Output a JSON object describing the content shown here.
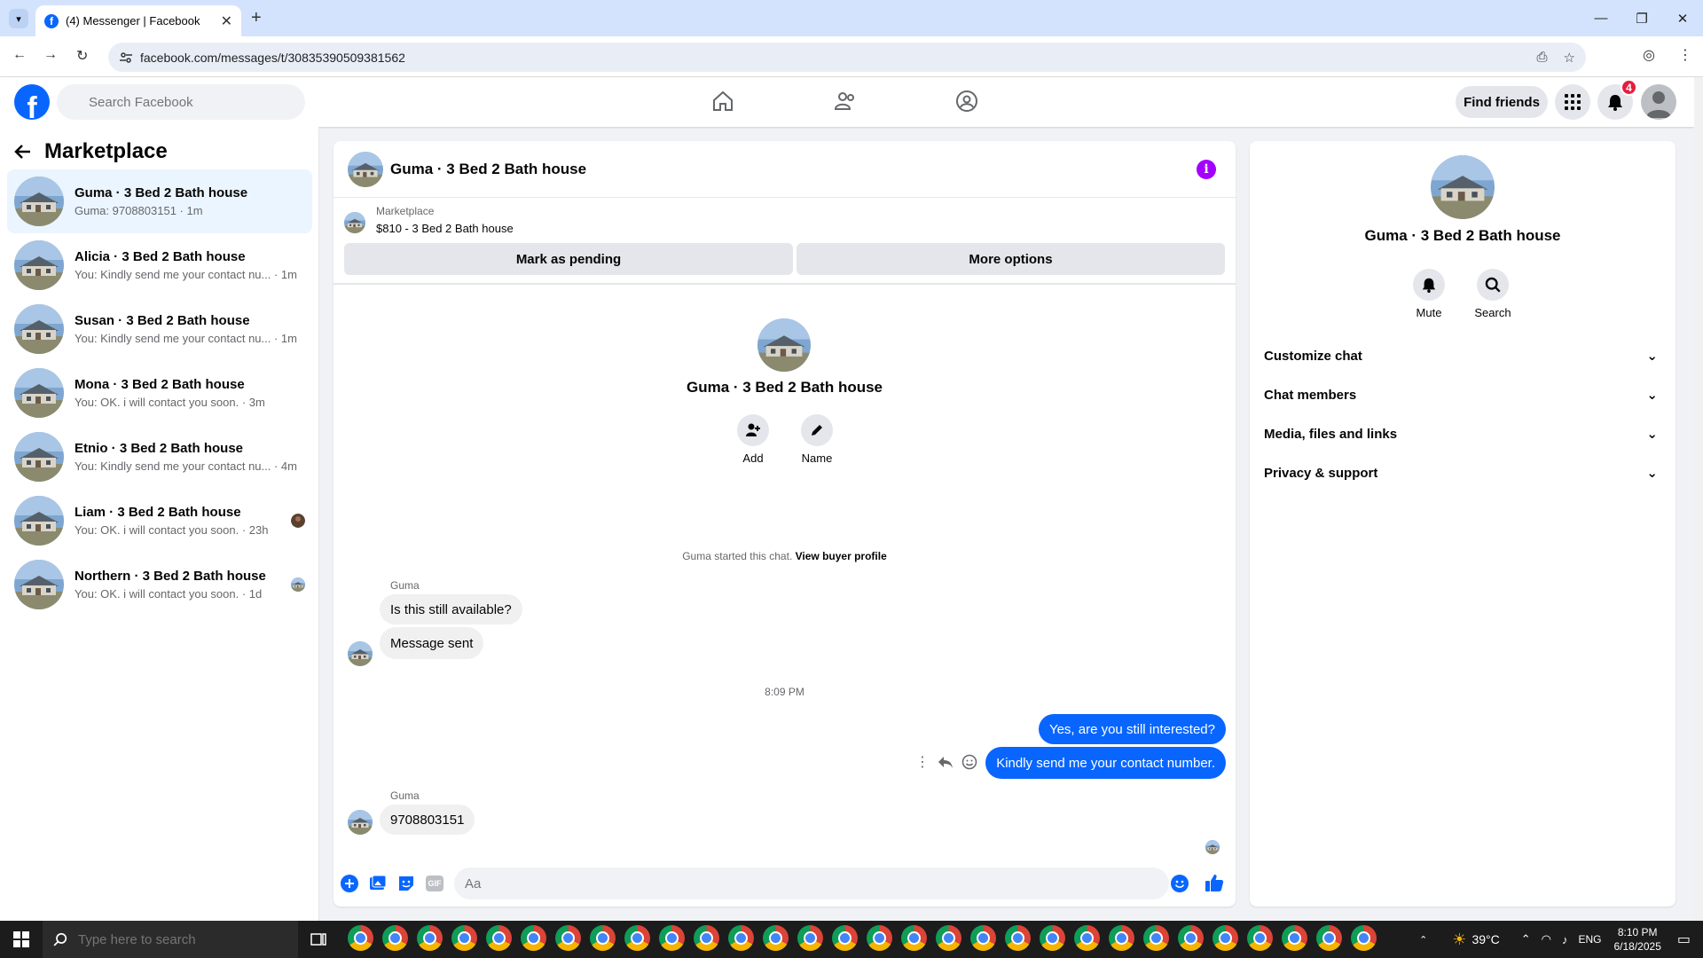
{
  "browser": {
    "tab_title": "(4) Messenger | Facebook",
    "url": "facebook.com/messages/t/30835390509381562"
  },
  "fb": {
    "logo_letter": "f",
    "search_placeholder": "Search Facebook",
    "find_friends": "Find friends",
    "notif_count": "4"
  },
  "sidebar": {
    "title": "Marketplace",
    "conversations": [
      {
        "name": "Guma · 3 Bed 2 Bath house",
        "preview": "Guma: 9708803151 · 1m"
      },
      {
        "name": "Alicia · 3 Bed 2 Bath house",
        "preview": "You: Kindly send me your contact nu... · 1m"
      },
      {
        "name": "Susan · 3 Bed 2 Bath house",
        "preview": "You: Kindly send me your contact nu... · 1m"
      },
      {
        "name": "Mona · 3 Bed 2 Bath house",
        "preview": "You: OK. i will contact you soon. · 3m"
      },
      {
        "name": "Etnio · 3 Bed 2 Bath house",
        "preview": "You: Kindly send me your contact nu... · 4m"
      },
      {
        "name": "Liam · 3 Bed 2 Bath house",
        "preview": "You: OK. i will contact you soon. · 23h"
      },
      {
        "name": "Northern · 3 Bed 2 Bath house",
        "preview": "You: OK. i will contact you soon. · 1d"
      }
    ]
  },
  "chat": {
    "title": "Guma · 3 Bed 2 Bath house",
    "info_glyph": "i",
    "listing_label": "Marketplace",
    "listing_price": "$810 - 3 Bed 2 Bath house",
    "mark_pending": "Mark as pending",
    "more_options": "More options",
    "profile_name": "Guma · 3 Bed 2 Bath house",
    "add_label": "Add",
    "name_label": "Name",
    "started_text": "Guma started this chat.",
    "view_profile": "View buyer profile",
    "sender": "Guma",
    "msg1": "Is this still available?",
    "msg2": "Message sent",
    "timestamp": "8:09 PM",
    "out1": "Yes, are you still interested?",
    "out2": "Kindly send me your contact number.",
    "sender2": "Guma",
    "msg3": "9708803151",
    "composer_placeholder": "Aa",
    "gif_label": "GIF"
  },
  "details": {
    "name": "Guma · 3 Bed 2 Bath house",
    "mute": "Mute",
    "search": "Search",
    "sections": [
      "Customize chat",
      "Chat members",
      "Media, files and links",
      "Privacy & support"
    ]
  },
  "taskbar": {
    "search_placeholder": "Type here to search",
    "temperature": "39°C",
    "language": "ENG",
    "time": "8:10 PM",
    "date": "6/18/2025"
  },
  "colors": {
    "brand": "#0866ff",
    "accent_purple": "#a200ff",
    "badge_red": "#e41e3f"
  }
}
